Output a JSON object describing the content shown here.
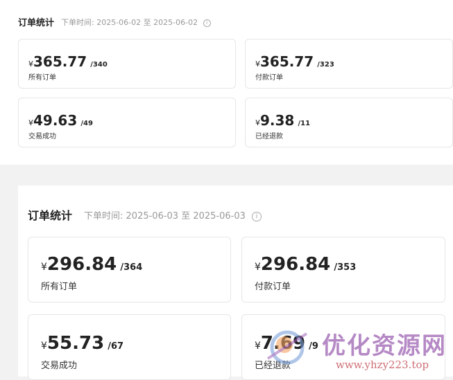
{
  "panels": [
    {
      "title": "订单统计",
      "date_label": "下单时间:",
      "date_range": "2025-06-02 至 2025-06-02",
      "cards": [
        {
          "currency": "¥",
          "amount": "365.77",
          "count": "/340",
          "label": "所有订单"
        },
        {
          "currency": "¥",
          "amount": "365.77",
          "count": "/323",
          "label": "付款订单"
        },
        {
          "currency": "¥",
          "amount": "49.63",
          "count": "/49",
          "label": "交易成功"
        },
        {
          "currency": "¥",
          "amount": "9.38",
          "count": "/11",
          "label": "已经退款"
        }
      ]
    },
    {
      "title": "订单统计",
      "date_label": "下单时间:",
      "date_range": "2025-06-03 至 2025-06-03",
      "cards": [
        {
          "currency": "¥",
          "amount": "296.84",
          "count": "/364",
          "label": "所有订单"
        },
        {
          "currency": "¥",
          "amount": "296.84",
          "count": "/353",
          "label": "付款订单"
        },
        {
          "currency": "¥",
          "amount": "55.73",
          "count": "/67",
          "label": "交易成功"
        },
        {
          "currency": "¥",
          "amount": "7.69",
          "count": "/9",
          "label": "已经退款"
        }
      ]
    }
  ],
  "info_icon": "info-circle-icon",
  "watermark": {
    "text": "优化资源网",
    "url": "www.yhzy223.top"
  }
}
